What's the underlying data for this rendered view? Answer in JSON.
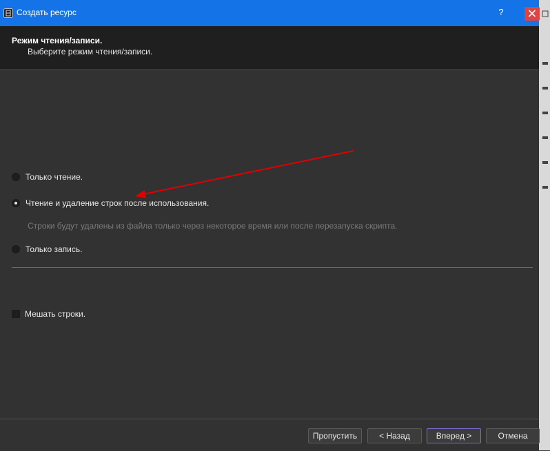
{
  "window": {
    "title": "Создать ресурс",
    "help_label": "?",
    "accent": "#1473e6",
    "close_color": "#e04343"
  },
  "header": {
    "title": "Режим чтения/записи.",
    "subtitle": "Выберите режим чтения/записи."
  },
  "modes": [
    {
      "label": "Только чтение.",
      "checked": false
    },
    {
      "label": "Чтение и удаление строк после использования.",
      "checked": true
    },
    {
      "label": "Только запись.",
      "checked": false
    }
  ],
  "hint": "Строки будут удалены из файла только через некоторое время или после перезапуска скрипта.",
  "shuffle": {
    "label": "Мешать строки.",
    "checked": false
  },
  "annotation": {
    "type": "red-arrow",
    "color": "#e00000"
  },
  "footer": {
    "skip": "Пропустить",
    "back": "< Назад",
    "next": "Вперед >",
    "cancel": "Отмена"
  }
}
